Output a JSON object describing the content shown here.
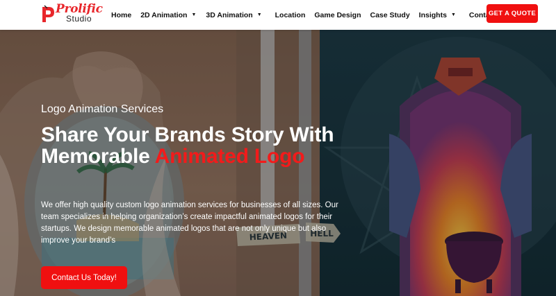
{
  "brand": {
    "name": "Prolific",
    "sub": "Studio",
    "accent_color": "#e8262b"
  },
  "nav": {
    "items": [
      {
        "label": "Home",
        "dropdown": false
      },
      {
        "label": "2D Animation",
        "dropdown": true
      },
      {
        "label": "3D Animation",
        "dropdown": true
      },
      {
        "label": "Location",
        "dropdown": false
      },
      {
        "label": "Game Design",
        "dropdown": false
      },
      {
        "label": "Case Study",
        "dropdown": false
      },
      {
        "label": "Insights",
        "dropdown": true
      },
      {
        "label": "Contact Us",
        "dropdown": false
      }
    ],
    "cta_label": "GET A QUOTE"
  },
  "hero": {
    "eyebrow": "Logo Animation Services",
    "headline_white": "Share Your Brands Story With Memorable",
    "headline_red": "Animated Logo",
    "description": "We offer high quality custom logo animation services for businesses of all sizes. Our team specializes in helping organization’s create impactful animated logos for their startups. We design memorable animated logos that are not only unique but also improve your brand’s",
    "button_label": "Contact Us Today!",
    "sign_left": "HEAVEN",
    "sign_right": "HELL",
    "cta_color": "#f01010"
  }
}
